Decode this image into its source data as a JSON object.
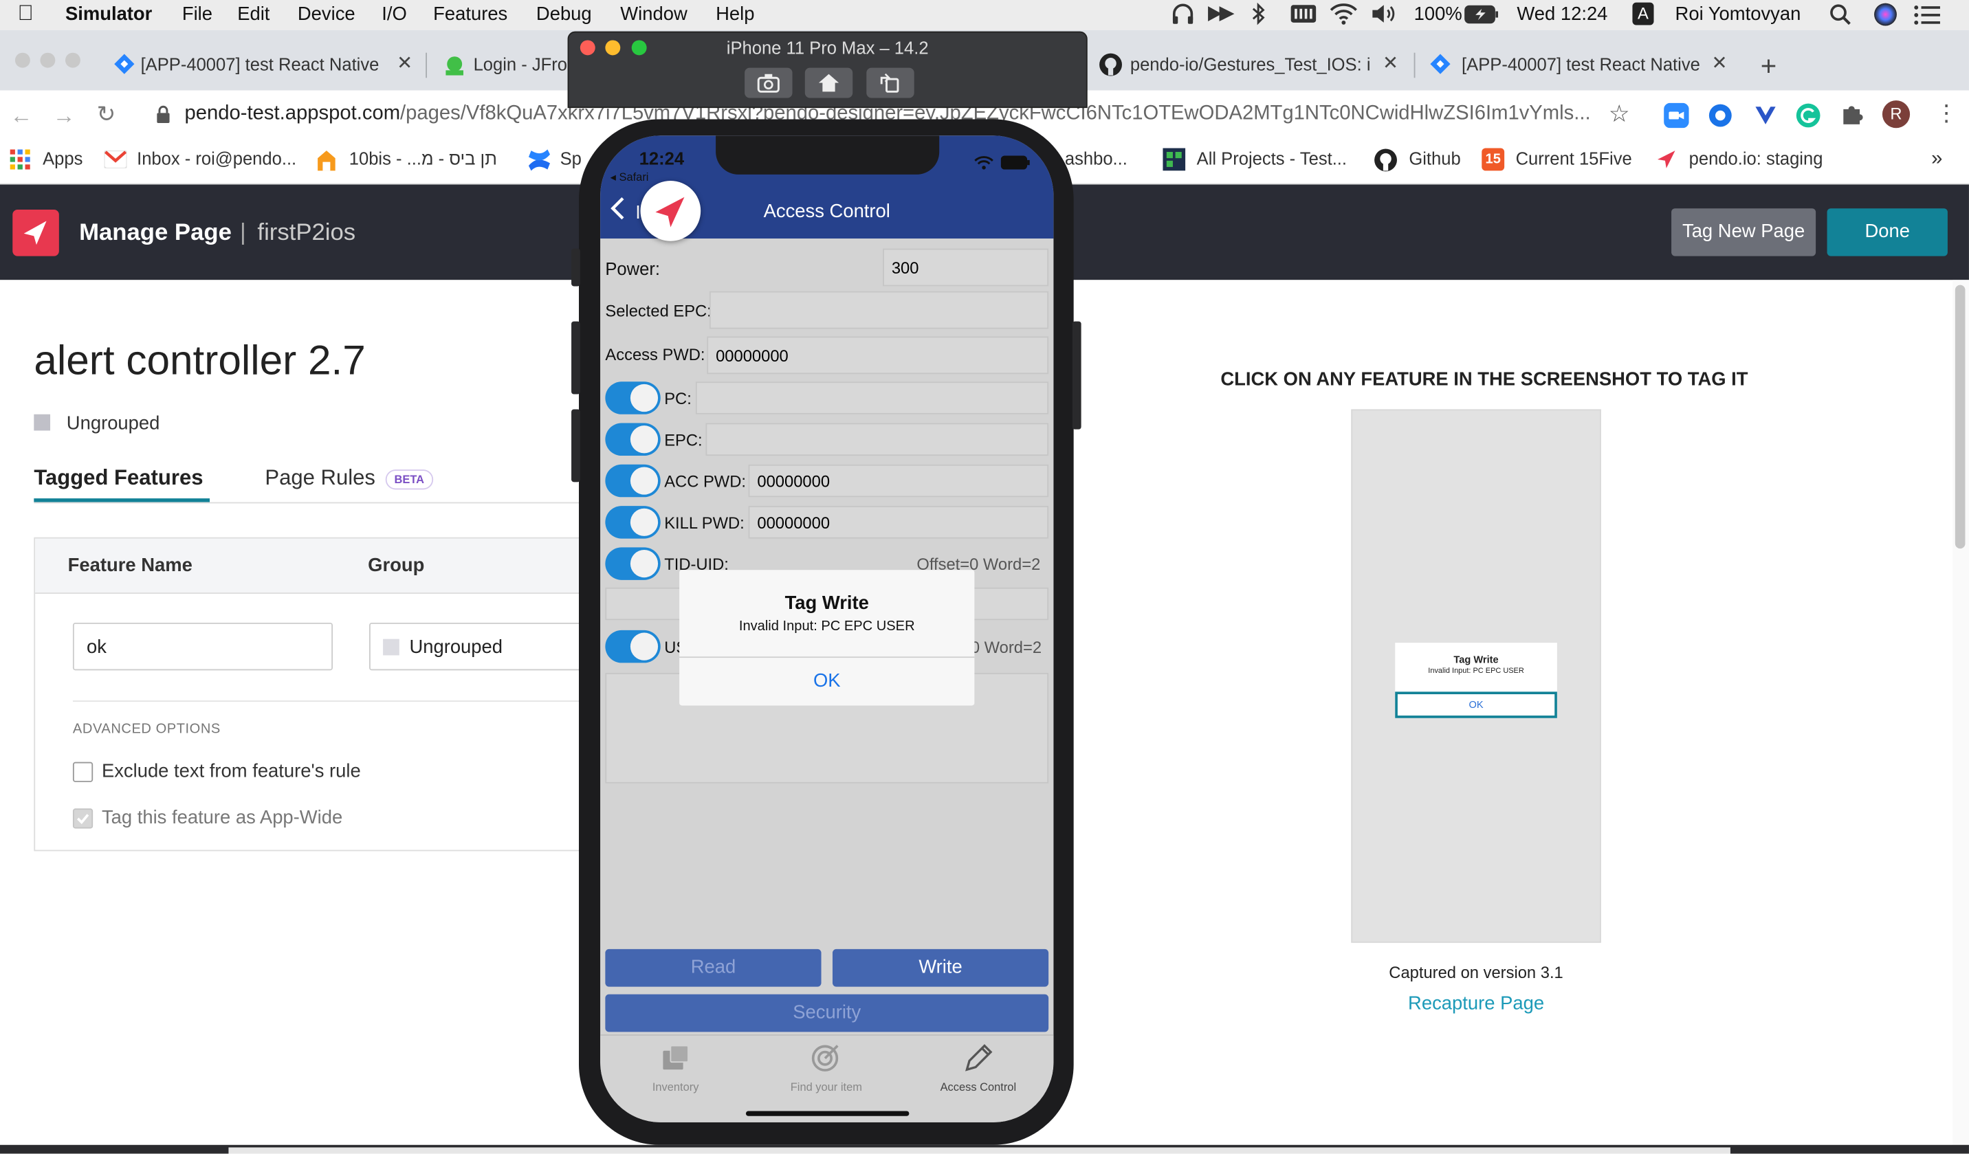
{
  "menubar": {
    "app": "Simulator",
    "items": [
      "File",
      "Edit",
      "Device",
      "I/O",
      "Features",
      "Debug",
      "Window",
      "Help"
    ],
    "battery": "100%",
    "clock": "Wed 12:24",
    "input_source": "A",
    "user": "Roi Yomtovyan"
  },
  "browser": {
    "tabs": [
      {
        "label": "[APP-40007] test React Native"
      },
      {
        "label": "Login - JFro"
      },
      {
        "label": "pendo-io/Gestures_Test_IOS: i"
      },
      {
        "label": "[APP-40007] test React Native"
      }
    ],
    "url_domain": "pendo-test.appspot.com",
    "url_path": "/pages/Vf8kQuA7xkrx7i7L5vm7V1Rrsxl?pendo-designer=ey.JpZEZyckFwcCI6NTc1OTEwODA2MTg1NTc0NCwidHlwZSI6Im1vYmls...",
    "avatar_letter": "R",
    "bookmarks": [
      "Apps",
      "Inbox - roi@pendo...",
      "10bis - ...תן ביס - מ",
      "Sp",
      "ashbo...",
      "All Projects - Test...",
      "Github",
      "Current 15Five",
      "pendo.io: staging"
    ],
    "bookmarks_more": "»",
    "current15_badge": "15"
  },
  "simulator": {
    "title": "iPhone 11 Pro Max – 14.2"
  },
  "pendo": {
    "header_title": "Manage Page",
    "header_sep": "|",
    "header_app": "firstP2ios",
    "tag_new_page": "Tag New Page",
    "done": "Done",
    "page_name": "alert controller 2.7",
    "group_label": "Ungrouped",
    "tabs": [
      "Tagged Features",
      "Page Rules"
    ],
    "beta": "BETA",
    "col_feature": "Feature Name",
    "col_group": "Group",
    "feature_value": "ok",
    "group_value": "Ungrouped",
    "advanced": "ADVANCED OPTIONS",
    "exclude_text": "Exclude text from feature's rule",
    "appwide_text": "Tag this feature as App-Wide",
    "instruction": "CLICK ON ANY FEATURE IN THE SCREENSHOT TO TAG IT",
    "thumb_title": "Tag Write",
    "thumb_msg": "Invalid Input: PC EPC USER",
    "thumb_ok": "OK",
    "captured": "Captured on version 3.1",
    "recapture": "Recapture Page"
  },
  "phone": {
    "time": "12:24",
    "back_app": "◂ Safari",
    "nav_title": "Access Control",
    "back_letter": "I",
    "power_label": "Power:",
    "power_value": "300",
    "selected_epc_label": "Selected EPC:",
    "access_pwd_label": "Access PWD:",
    "access_pwd_value": "00000000",
    "pc_label": "PC:",
    "epc_label": "EPC:",
    "acc_pwd_label": "ACC PWD:",
    "acc_pwd_value": "00000000",
    "kill_pwd_label": "KILL PWD:",
    "kill_pwd_value": "00000000",
    "tid_label": "TID-UID:",
    "tid_offset": "Offset=0 Word=2",
    "us_label": "US",
    "us_offset": "0 Word=2",
    "alert_title": "Tag Write",
    "alert_msg": "Invalid Input: PC EPC USER",
    "alert_ok": "OK",
    "btn_read": "Read",
    "btn_write": "Write",
    "btn_security": "Security",
    "tab_inventory": "Inventory",
    "tab_find": "Find your item",
    "tab_access": "Access Control"
  },
  "colors": {
    "pendo_pink": "#e8384f",
    "pendo_teal": "#128297",
    "ios_nav": "#26418c",
    "ios_button": "#4466b0"
  }
}
